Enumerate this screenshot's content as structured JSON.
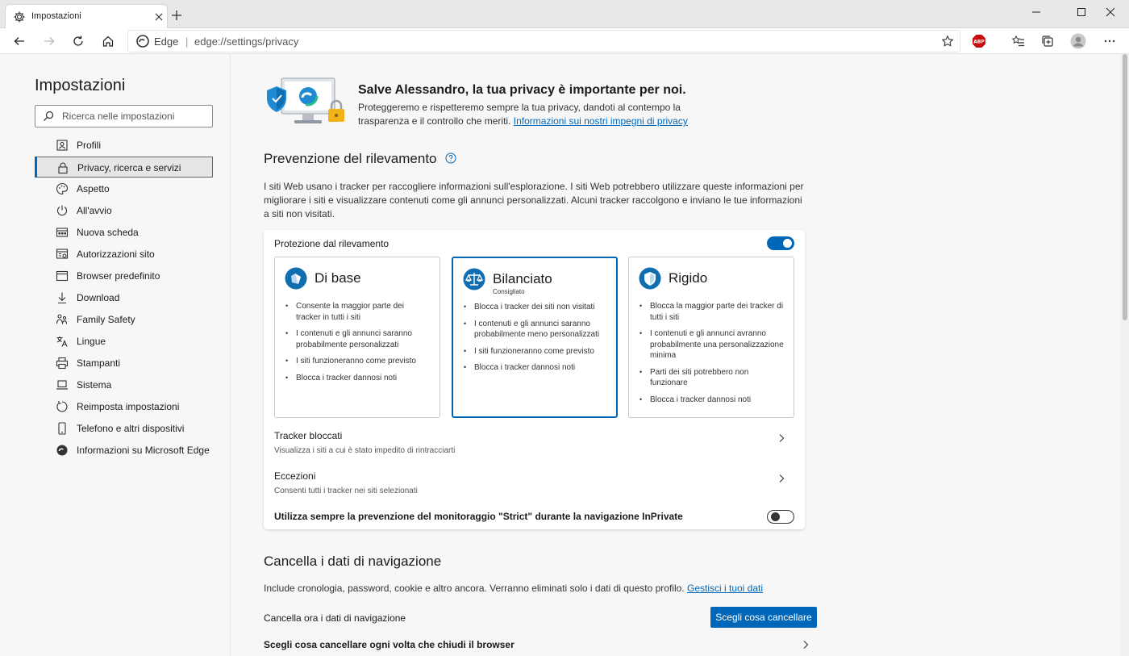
{
  "browser": {
    "tab_title": "Impostazioni",
    "site_label": "Edge",
    "separator": "|",
    "url": "edge://settings/privacy",
    "extension_badge": "ABP"
  },
  "sidebar": {
    "title": "Impostazioni",
    "search_placeholder": "Ricerca nelle impostazioni",
    "items": [
      {
        "label": "Profili",
        "icon": "profile-icon"
      },
      {
        "label": "Privacy, ricerca e servizi",
        "icon": "lock-icon",
        "active": true
      },
      {
        "label": "Aspetto",
        "icon": "palette-icon"
      },
      {
        "label": "All'avvio",
        "icon": "power-icon"
      },
      {
        "label": "Nuova scheda",
        "icon": "new-tab-icon"
      },
      {
        "label": "Autorizzazioni sito",
        "icon": "site-permissions-icon"
      },
      {
        "label": "Browser predefinito",
        "icon": "browser-icon"
      },
      {
        "label": "Download",
        "icon": "download-icon"
      },
      {
        "label": "Family Safety",
        "icon": "family-icon"
      },
      {
        "label": "Lingue",
        "icon": "language-icon"
      },
      {
        "label": "Stampanti",
        "icon": "printer-icon"
      },
      {
        "label": "Sistema",
        "icon": "laptop-icon"
      },
      {
        "label": "Reimposta impostazioni",
        "icon": "reset-icon"
      },
      {
        "label": "Telefono e altri dispositivi",
        "icon": "phone-icon"
      },
      {
        "label": "Informazioni su Microsoft Edge",
        "icon": "edge-icon"
      }
    ]
  },
  "hero": {
    "title": "Salve Alessandro, la tua privacy è importante per noi.",
    "desc": "Proteggeremo e rispetteremo sempre la tua privacy, dandoti al contempo la trasparenza e il controllo che meriti.",
    "link": "Informazioni sui nostri impegni di privacy"
  },
  "tracking": {
    "title": "Prevenzione del rilevamento",
    "desc": "I siti Web usano i tracker per raccogliere informazioni sull'esplorazione. I siti Web potrebbero utilizzare queste informazioni per migliorare i siti e visualizzare contenuti come gli annunci personalizzati. Alcuni tracker raccolgono e inviano le tue informazioni a siti non visitati.",
    "protection_label": "Protezione dal rilevamento",
    "protection_on": true,
    "levels": [
      {
        "title": "Di base",
        "subtitle": "",
        "selected": false,
        "bullets": [
          "Consente la maggior parte dei tracker in tutti i siti",
          "I contenuti e gli annunci saranno probabilmente personalizzati",
          "I siti funzioneranno come previsto",
          "Blocca i tracker dannosi noti"
        ]
      },
      {
        "title": "Bilanciato",
        "subtitle": "Consigliato",
        "selected": true,
        "bullets": [
          "Blocca i tracker dei siti non visitati",
          "I contenuti e gli annunci saranno probabilmente meno personalizzati",
          "I siti funzioneranno come previsto",
          "Blocca i tracker dannosi noti"
        ]
      },
      {
        "title": "Rigido",
        "subtitle": "",
        "selected": false,
        "bullets": [
          "Blocca la maggior parte dei tracker di tutti i siti",
          "I contenuti e gli annunci avranno probabilmente una personalizzazione minima",
          "Parti dei siti potrebbero non funzionare",
          "Blocca i tracker dannosi noti"
        ]
      }
    ],
    "blocked": {
      "title": "Tracker bloccati",
      "sub": "Visualizza i siti a cui è stato impedito di rintracciarti"
    },
    "exceptions": {
      "title": "Eccezioni",
      "sub": "Consenti tutti i tracker nei siti selezionati"
    },
    "strict_label": "Utilizza sempre la prevenzione del monitoraggio \"Strict\" durante la navigazione InPrivate",
    "strict_on": false
  },
  "clear": {
    "title": "Cancella i dati di navigazione",
    "desc": "Include cronologia, password, cookie e altro ancora. Verranno eliminati solo i dati di questo profilo.",
    "link": "Gestisci i tuoi dati",
    "now_label": "Cancella ora i dati di navigazione",
    "button": "Scegli cosa cancellare",
    "on_close_label": "Scegli cosa cancellare ogni volta che chiudi il browser"
  },
  "colors": {
    "accent": "#0067b8",
    "abp": "#c70d0d"
  }
}
